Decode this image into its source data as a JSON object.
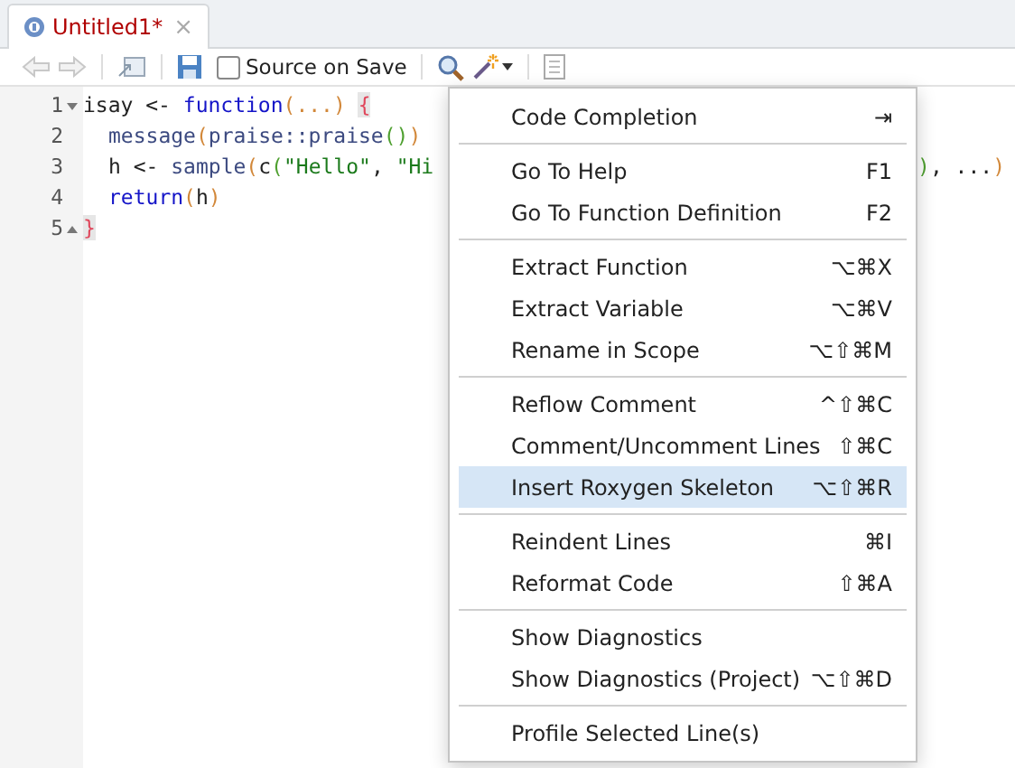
{
  "tab": {
    "title": "Untitled1*",
    "modified": true,
    "close": "×"
  },
  "toolbar": {
    "source_on_save": {
      "label": "Source on Save",
      "checked": false
    }
  },
  "editor": {
    "lines": [
      {
        "number": "1",
        "fold_start": true,
        "fold_end": false,
        "indented": false,
        "tokens": [
          {
            "kind": "plain",
            "text": "isay <- "
          },
          {
            "kind": "keyword",
            "text": "function"
          },
          {
            "kind": "paren",
            "text": "(...) "
          },
          {
            "kind": "brace",
            "text": "{"
          }
        ]
      },
      {
        "number": "2",
        "fold_start": false,
        "fold_end": false,
        "indented": true,
        "tokens": [
          {
            "kind": "call",
            "text": "message"
          },
          {
            "kind": "paren",
            "text": "("
          },
          {
            "kind": "call",
            "text": "praise::praise"
          },
          {
            "kind": "paren2",
            "text": "()"
          },
          {
            "kind": "paren",
            "text": ")"
          }
        ]
      },
      {
        "number": "3",
        "fold_start": false,
        "fold_end": false,
        "indented": true,
        "tokens": [
          {
            "kind": "plain",
            "text": "h <- "
          },
          {
            "kind": "call",
            "text": "sample"
          },
          {
            "kind": "paren",
            "text": "("
          },
          {
            "kind": "plain",
            "text": "c"
          },
          {
            "kind": "paren2",
            "text": "("
          },
          {
            "kind": "string",
            "text": "\"Hello\""
          },
          {
            "kind": "plain",
            "text": ", "
          },
          {
            "kind": "string",
            "text": "\"Hi"
          }
        ],
        "tail": [
          {
            "kind": "paren2",
            "text": ")"
          },
          {
            "kind": "plain",
            "text": ", ..."
          },
          {
            "kind": "paren",
            "text": ")"
          }
        ]
      },
      {
        "number": "4",
        "fold_start": false,
        "fold_end": false,
        "indented": true,
        "tokens": [
          {
            "kind": "keyword",
            "text": "return"
          },
          {
            "kind": "paren",
            "text": "("
          },
          {
            "kind": "plain",
            "text": "h"
          },
          {
            "kind": "paren",
            "text": ")"
          }
        ]
      },
      {
        "number": "5",
        "fold_start": false,
        "fold_end": true,
        "indented": false,
        "tokens": [
          {
            "kind": "brace",
            "text": "}"
          }
        ]
      }
    ]
  },
  "menu": {
    "items": [
      {
        "kind": "item",
        "label": "Code Completion",
        "shortcut": "⇥",
        "selected": false
      },
      {
        "kind": "separator"
      },
      {
        "kind": "item",
        "label": "Go To Help",
        "shortcut": "F1",
        "selected": false
      },
      {
        "kind": "item",
        "label": "Go To Function Definition",
        "shortcut": "F2",
        "selected": false
      },
      {
        "kind": "separator"
      },
      {
        "kind": "item",
        "label": "Extract Function",
        "shortcut": "⌥⌘X",
        "selected": false
      },
      {
        "kind": "item",
        "label": "Extract Variable",
        "shortcut": "⌥⌘V",
        "selected": false
      },
      {
        "kind": "item",
        "label": "Rename in Scope",
        "shortcut": "⌥⇧⌘M",
        "selected": false
      },
      {
        "kind": "separator"
      },
      {
        "kind": "item",
        "label": "Reflow Comment",
        "shortcut": "^⇧⌘C",
        "selected": false
      },
      {
        "kind": "item",
        "label": "Comment/Uncomment Lines",
        "shortcut": "⇧⌘C",
        "selected": false
      },
      {
        "kind": "item",
        "label": "Insert Roxygen Skeleton",
        "shortcut": "⌥⇧⌘R",
        "selected": true
      },
      {
        "kind": "separator"
      },
      {
        "kind": "item",
        "label": "Reindent Lines",
        "shortcut": "⌘I",
        "selected": false
      },
      {
        "kind": "item",
        "label": "Reformat Code",
        "shortcut": "⇧⌘A",
        "selected": false
      },
      {
        "kind": "separator"
      },
      {
        "kind": "item",
        "label": "Show Diagnostics",
        "selected": false
      },
      {
        "kind": "item",
        "label": "Show Diagnostics (Project)",
        "shortcut": "⌥⇧⌘D",
        "selected": false
      },
      {
        "kind": "separator"
      },
      {
        "kind": "item",
        "label": "Profile Selected Line(s)",
        "selected": false
      }
    ]
  }
}
